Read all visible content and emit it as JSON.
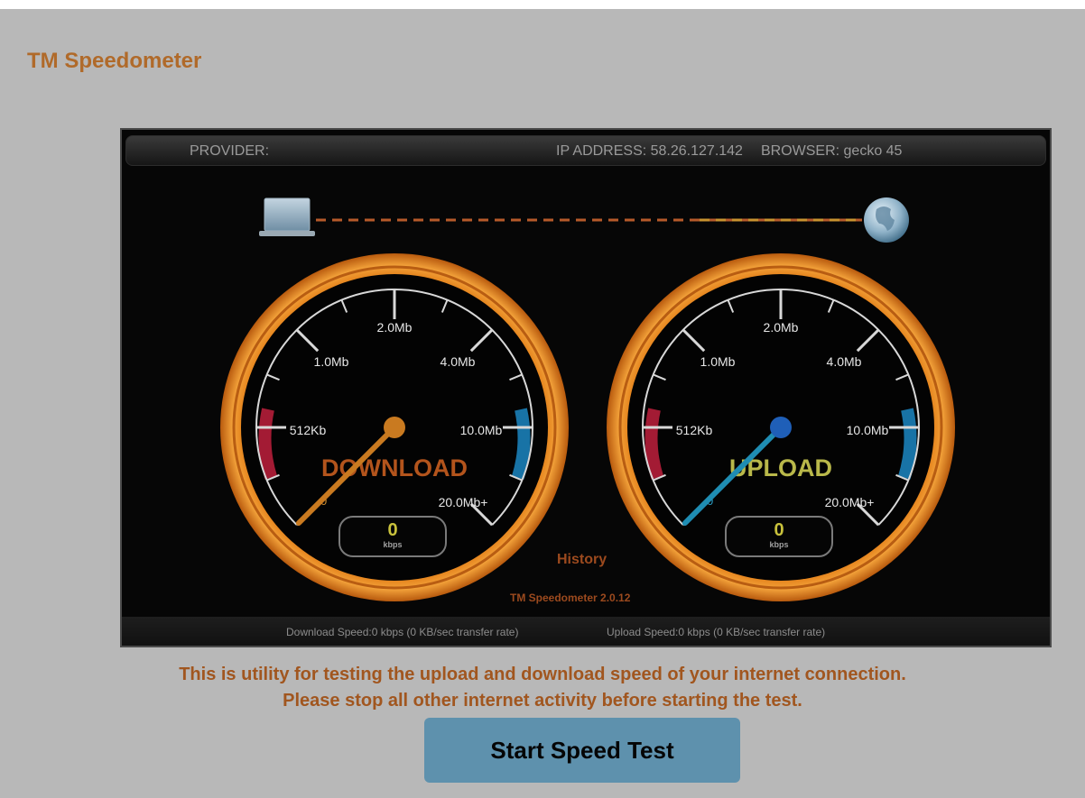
{
  "app": {
    "title": "TM Speedometer"
  },
  "info_bar": {
    "provider_label": "PROVIDER:",
    "ip_label": "IP ADDRESS: 58.26.127.142",
    "browser_label": "BROWSER: gecko 45"
  },
  "gauges": {
    "scale_labels": [
      "512Kb",
      "1.0Mb",
      "2.0Mb",
      "4.0Mb",
      "10.0Mb",
      "20.0Mb+"
    ],
    "zero_label": "0",
    "download": {
      "title": "DOWNLOAD",
      "value": "0",
      "unit": "kbps",
      "needle_color": "#c97a20",
      "title_color": "#b3541c"
    },
    "upload": {
      "title": "UPLOAD",
      "value": "0",
      "unit": "kbps",
      "needle_color": "#1f8db3",
      "title_color": "#b9b84a"
    }
  },
  "history_link": "History",
  "version": "TM Speedometer 2.0.12",
  "stats": {
    "download": "Download Speed:0 kbps (0 KB/sec transfer rate)",
    "upload": "Upload Speed:0 kbps (0 KB/sec transfer rate)"
  },
  "description": {
    "line1": "This is utility for testing the upload and download speed of your internet connection.",
    "line2": "Please stop all other internet activity before starting the test."
  },
  "start_button": "Start Speed Test",
  "colors": {
    "accent": "#b06a2a",
    "gauge_ring": "#d9781c",
    "button": "#5e91ad",
    "page_bg": "#b8b8b8"
  },
  "icons": {
    "computer": "laptop-icon",
    "internet": "globe-icon"
  }
}
